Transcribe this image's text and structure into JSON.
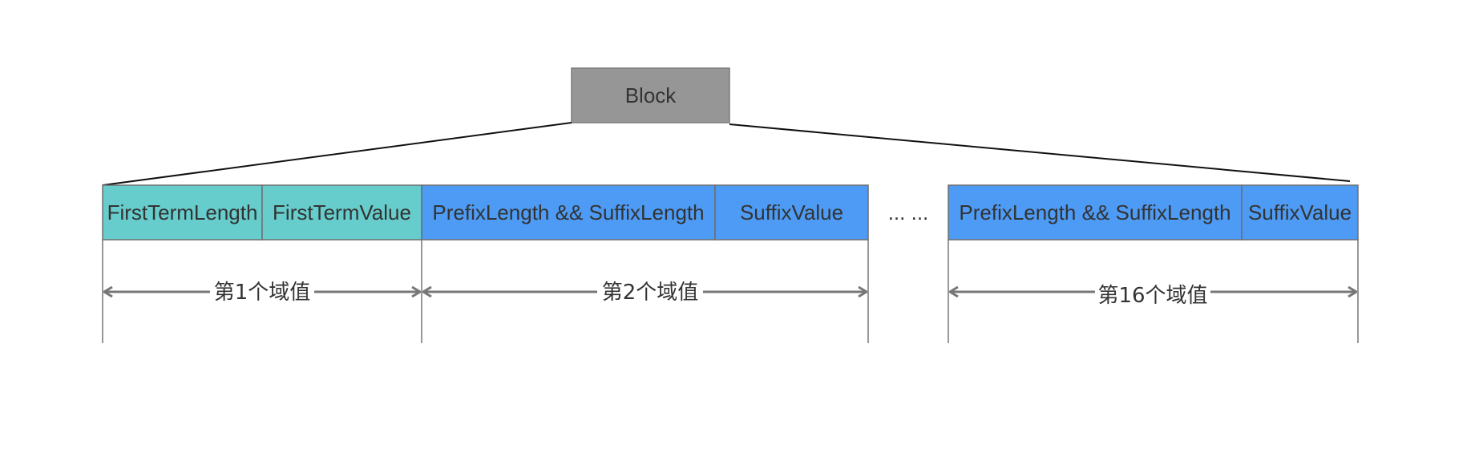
{
  "block": {
    "label": "Block",
    "color": "#969696"
  },
  "colors": {
    "first_field": "#66CCCC",
    "other_field": "#4D9BF5",
    "border": "#6E6E6E",
    "arrow": "#777777",
    "text": "#333333"
  },
  "cells": {
    "first_term_length": "FirstTermLength",
    "first_term_value": "FirstTermValue",
    "prefix_suffix_length_2": "PrefixLength && SuffixLength",
    "suffix_value_2": "SuffixValue",
    "ellipsis": "... ...",
    "prefix_suffix_length_16": "PrefixLength && SuffixLength",
    "suffix_value_16": "SuffixValue"
  },
  "fields": {
    "field_1": "第1个域值",
    "field_2": "第2个域值",
    "field_16": "第16个域值"
  }
}
